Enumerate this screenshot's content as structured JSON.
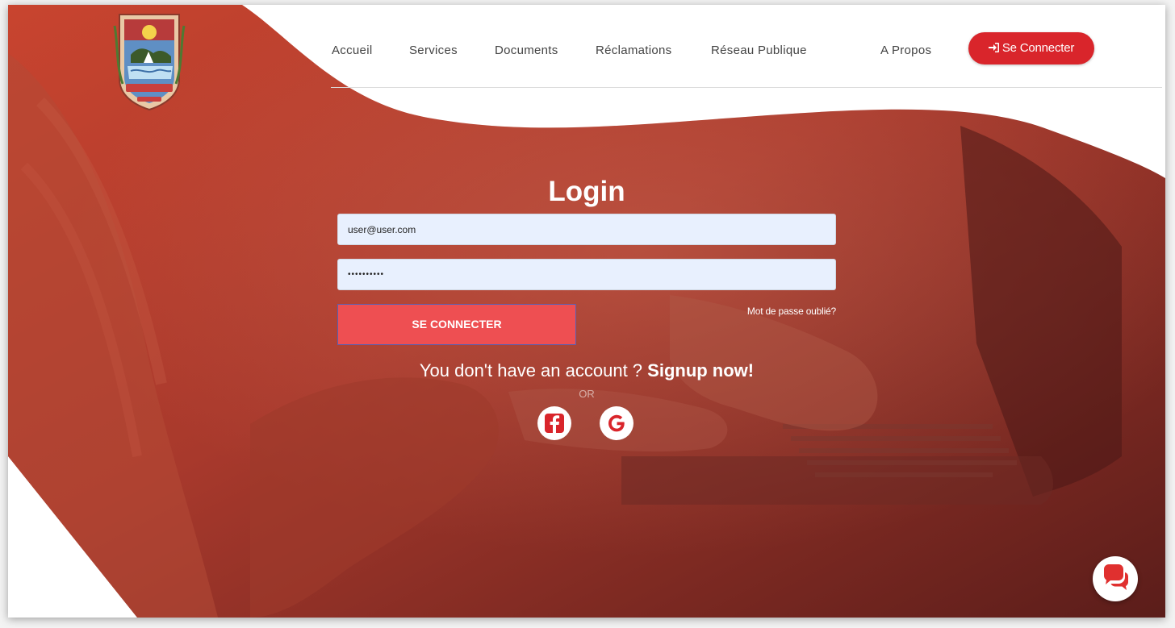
{
  "nav": {
    "items": [
      {
        "label": "Accueil"
      },
      {
        "label": "Services"
      },
      {
        "label": "Documents"
      },
      {
        "label": "Réclamations"
      },
      {
        "label": "Réseau Publique"
      },
      {
        "label": "A Propos"
      }
    ],
    "connect_label": "Se Connecter",
    "connect_icon": "sign-in-icon"
  },
  "login": {
    "title": "Login",
    "email_value": "user@user.com",
    "password_value": "••••••••••",
    "submit_label": "SE CONNECTER",
    "forgot_label": "Mot de passe oublié?",
    "signup_prefix": "You don't have an account ? ",
    "signup_link": "Signup now!",
    "or_label": "OR",
    "social": [
      "facebook-icon",
      "google-icon"
    ]
  },
  "chat": {
    "icon": "chat-bubbles-icon"
  },
  "colors": {
    "accent": "#d9252b",
    "button": "#ee4f52",
    "overlay": "#b83a2c",
    "input_bg": "#e8f0fe"
  }
}
